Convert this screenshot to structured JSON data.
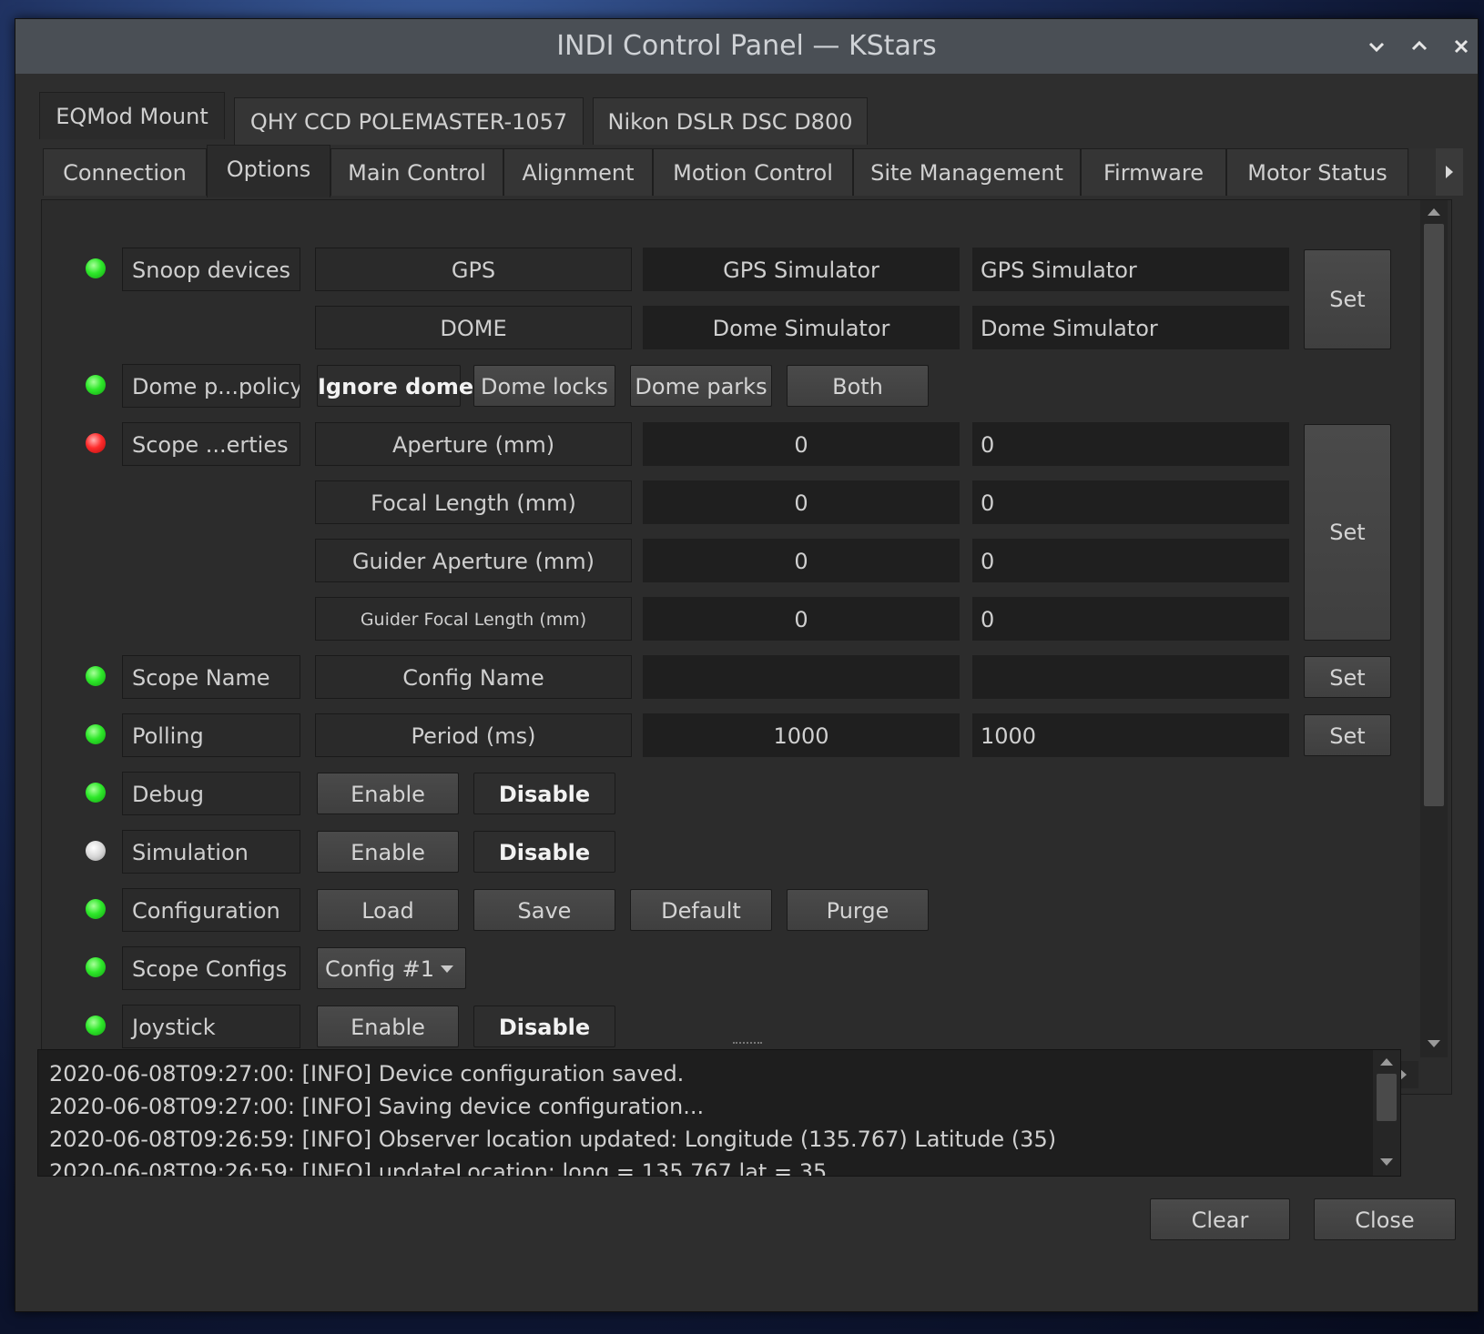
{
  "window": {
    "title": "INDI Control Panel — KStars"
  },
  "device_tabs": [
    {
      "label": "EQMod Mount"
    },
    {
      "label": "QHY CCD POLEMASTER-1057"
    },
    {
      "label": "Nikon DSLR DSC D800"
    }
  ],
  "group_tabs": [
    {
      "label": "Connection"
    },
    {
      "label": "Options"
    },
    {
      "label": "Main Control"
    },
    {
      "label": "Alignment"
    },
    {
      "label": "Motion Control"
    },
    {
      "label": "Site Management"
    },
    {
      "label": "Firmware"
    },
    {
      "label": "Motor Status"
    }
  ],
  "properties": {
    "snoop": {
      "label": "Snoop devices",
      "status_color": "#2ee82a",
      "rows": [
        {
          "name": "GPS",
          "current": "GPS Simulator",
          "input": "GPS Simulator"
        },
        {
          "name": "DOME",
          "current": "Dome Simulator",
          "input": "Dome Simulator"
        }
      ],
      "set_label": "Set"
    },
    "dome_policy": {
      "label": "Dome p...policy",
      "status_color": "#2ee82a",
      "options": [
        "Ignore dome",
        "Dome locks",
        "Dome parks",
        "Both"
      ]
    },
    "scope_props": {
      "label": "Scope ...erties",
      "status_color": "#ff2c2c",
      "rows": [
        {
          "name": "Aperture (mm)",
          "current": "0",
          "input": "0"
        },
        {
          "name": "Focal Length (mm)",
          "current": "0",
          "input": "0"
        },
        {
          "name": "Guider Aperture (mm)",
          "current": "0",
          "input": "0"
        },
        {
          "name": "Guider Focal Length (mm)",
          "current": "0",
          "input": "0"
        }
      ],
      "set_label": "Set"
    },
    "scope_name": {
      "label": "Scope Name",
      "status_color": "#2ee82a",
      "row": {
        "name": "Config Name",
        "current": "",
        "input": ""
      },
      "set_label": "Set"
    },
    "polling": {
      "label": "Polling",
      "status_color": "#2ee82a",
      "row": {
        "name": "Period (ms)",
        "current": "1000",
        "input": "1000"
      },
      "set_label": "Set"
    },
    "debug": {
      "label": "Debug",
      "status_color": "#2ee82a",
      "options": [
        "Enable",
        "Disable"
      ]
    },
    "simulation": {
      "label": "Simulation",
      "status_color": "#d8d8d8",
      "options": [
        "Enable",
        "Disable"
      ]
    },
    "configuration": {
      "label": "Configuration",
      "status_color": "#2ee82a",
      "options": [
        "Load",
        "Save",
        "Default",
        "Purge"
      ]
    },
    "scope_configs": {
      "label": "Scope Configs",
      "status_color": "#2ee82a",
      "selected": "Config #1"
    },
    "joystick": {
      "label": "Joystick",
      "status_color": "#2ee82a",
      "options": [
        "Enable",
        "Disable"
      ]
    }
  },
  "log": [
    "2020-06-08T09:27:00: [INFO] Device configuration saved.",
    "2020-06-08T09:27:00: [INFO] Saving device configuration...",
    "2020-06-08T09:26:59: [INFO] Observer location updated: Longitude (135.767) Latitude (35)",
    "2020-06-08T09:26:59: [INFO] updateLocation: long = 135.767 lat = 35"
  ],
  "footer": {
    "clear_label": "Clear",
    "close_label": "Close"
  }
}
